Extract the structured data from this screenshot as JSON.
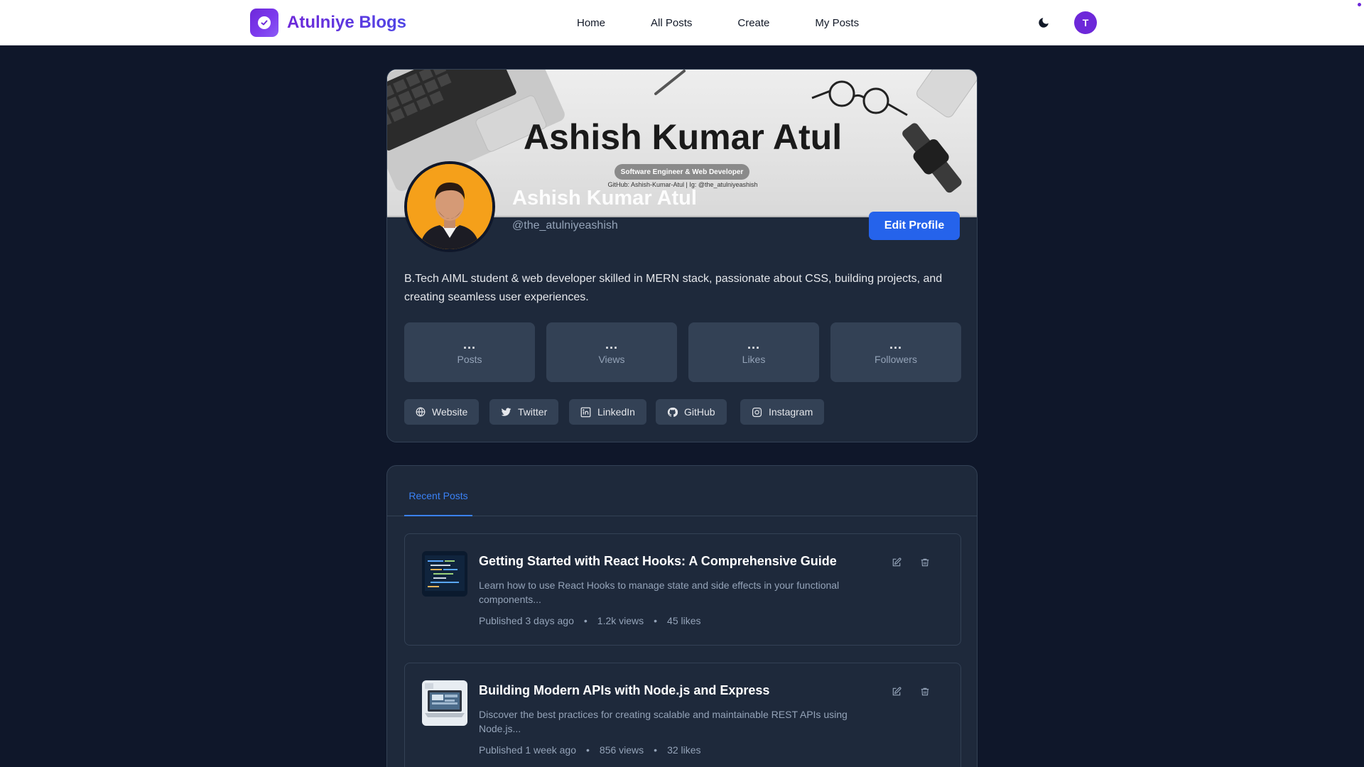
{
  "navbar": {
    "brand": "Atulniye Blogs",
    "links": [
      "Home",
      "All Posts",
      "Create",
      "My Posts"
    ],
    "avatar_initial": "T"
  },
  "profile": {
    "banner": {
      "name": "Ashish Kumar Atul",
      "role": "Software Engineer & Web Developer",
      "socials_line": "GitHub: Ashish-Kumar-Atul  | Ig: @the_atulniyeashish"
    },
    "display_name": "Ashish Kumar Atul",
    "username": "@the_atulniyeashish",
    "edit_button": "Edit Profile",
    "bio": "B.Tech AIML student & web developer skilled in MERN stack, passionate about CSS, building projects, and creating seamless user experiences.",
    "stats": [
      {
        "value": "...",
        "label": "Posts"
      },
      {
        "value": "...",
        "label": "Views"
      },
      {
        "value": "...",
        "label": "Likes"
      },
      {
        "value": "...",
        "label": "Followers"
      }
    ],
    "socials": [
      {
        "label": "Website",
        "icon": "globe-icon"
      },
      {
        "label": "Twitter",
        "icon": "twitter-icon"
      },
      {
        "label": "LinkedIn",
        "icon": "linkedin-icon"
      },
      {
        "label": "GitHub",
        "icon": "github-icon"
      },
      {
        "label": "Instagram",
        "icon": "instagram-icon"
      }
    ]
  },
  "posts_section": {
    "tab": "Recent Posts",
    "posts": [
      {
        "title": "Getting Started with React Hooks: A Comprehensive Guide",
        "excerpt": "Learn how to use React Hooks to manage state and side effects in your functional components...",
        "published": "Published 3 days ago",
        "views": "1.2k views",
        "likes": "45 likes"
      },
      {
        "title": "Building Modern APIs with Node.js and Express",
        "excerpt": "Discover the best practices for creating scalable and maintainable REST APIs using Node.js...",
        "published": "Published 1 week ago",
        "views": "856 views",
        "likes": "32 likes"
      }
    ]
  },
  "colors": {
    "page_bg": "#0f172a",
    "card_bg": "#1e293b",
    "accent_blue": "#2563eb",
    "brand_purple": "#6d28d9"
  }
}
